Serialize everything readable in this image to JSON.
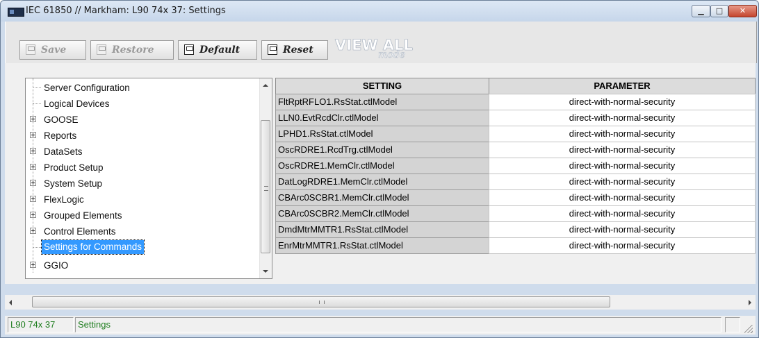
{
  "window": {
    "title": "IEC 61850 // Markham: L90 74x 37: Settings",
    "controls": {
      "minimize": "▁",
      "maximize": "□",
      "close": "✕"
    }
  },
  "toolbar": {
    "save_label": "Save",
    "restore_label": "Restore",
    "default_label": "Default",
    "reset_label": "Reset",
    "view_all_label": "VIEW ALL",
    "view_all_mode": "mode"
  },
  "tree": {
    "items": [
      {
        "label": "Server Configuration",
        "expandable": false
      },
      {
        "label": "Logical Devices",
        "expandable": false
      },
      {
        "label": "GOOSE",
        "expandable": true
      },
      {
        "label": "Reports",
        "expandable": true
      },
      {
        "label": "DataSets",
        "expandable": true
      },
      {
        "label": "Product Setup",
        "expandable": true
      },
      {
        "label": "System Setup",
        "expandable": true
      },
      {
        "label": "FlexLogic",
        "expandable": true
      },
      {
        "label": "Grouped Elements",
        "expandable": true
      },
      {
        "label": "Control Elements",
        "expandable": true
      },
      {
        "label": "Settings for Commands",
        "expandable": false,
        "selected": true
      },
      {
        "label": "GGIO",
        "expandable": true
      }
    ]
  },
  "table": {
    "headers": {
      "setting": "SETTING",
      "parameter": "PARAMETER"
    },
    "rows": [
      {
        "setting": "FltRptRFLO1.RsStat.ctlModel",
        "parameter": "direct-with-normal-security"
      },
      {
        "setting": "LLN0.EvtRcdClr.ctlModel",
        "parameter": "direct-with-normal-security"
      },
      {
        "setting": "LPHD1.RsStat.ctlModel",
        "parameter": "direct-with-normal-security"
      },
      {
        "setting": "OscRDRE1.RcdTrg.ctlModel",
        "parameter": "direct-with-normal-security"
      },
      {
        "setting": "OscRDRE1.MemClr.ctlModel",
        "parameter": "direct-with-normal-security"
      },
      {
        "setting": "DatLogRDRE1.MemClr.ctlModel",
        "parameter": "direct-with-normal-security"
      },
      {
        "setting": "CBArc0SCBR1.MemClr.ctlModel",
        "parameter": "direct-with-normal-security"
      },
      {
        "setting": "CBArc0SCBR2.MemClr.ctlModel",
        "parameter": "direct-with-normal-security"
      },
      {
        "setting": "DmdMtrMMTR1.RsStat.ctlModel",
        "parameter": "direct-with-normal-security"
      },
      {
        "setting": "EnrMtrMMTR1.RsStat.ctlModel",
        "parameter": "direct-with-normal-security"
      }
    ]
  },
  "scrollbar": {
    "grip_h": "III"
  },
  "status": {
    "device": "L90 74x 37",
    "page": "Settings"
  },
  "colors": {
    "selection": "#3399ff",
    "status_text": "#1e7d1e",
    "close_button": "#c4452e"
  }
}
